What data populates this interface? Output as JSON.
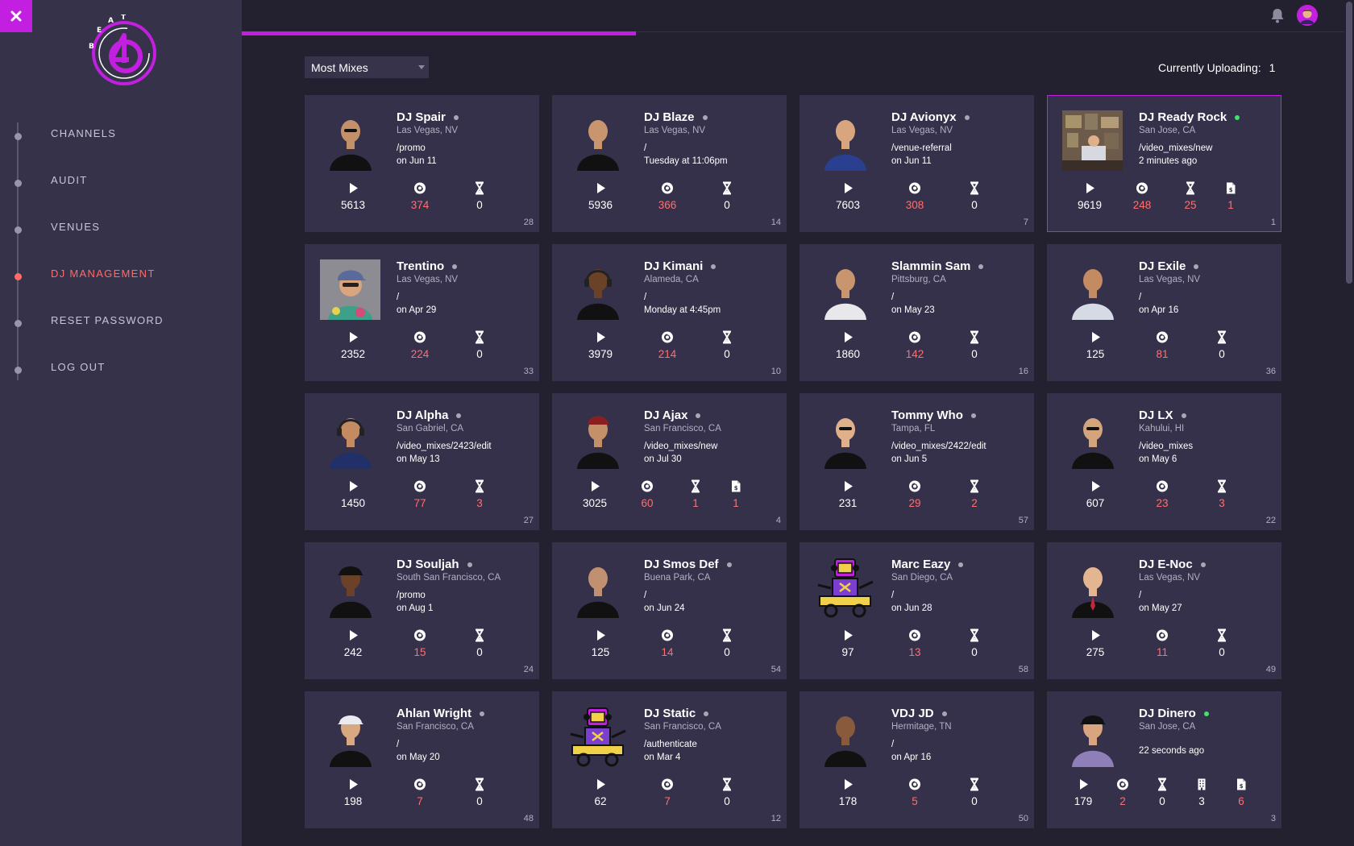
{
  "app": {
    "brand": "BEAT 45"
  },
  "sidebar": {
    "items": [
      {
        "label": "CHANNELS",
        "active": false
      },
      {
        "label": "AUDIT",
        "active": false
      },
      {
        "label": "VENUES",
        "active": false
      },
      {
        "label": "DJ MANAGEMENT",
        "active": true
      },
      {
        "label": "RESET PASSWORD",
        "active": false
      },
      {
        "label": "LOG OUT",
        "active": false
      }
    ]
  },
  "controls": {
    "sort_label": "Most Mixes",
    "uploading_label": "Currently Uploading:",
    "uploading_count": "1"
  },
  "colors": {
    "accent": "#c21fe0",
    "active_nav": "#ff6a6a",
    "online": "#3ee46a",
    "stat_red": "#ff6f6f"
  },
  "djs": [
    {
      "name": "DJ Spair",
      "location": "Las Vegas, NV",
      "path": "/promo",
      "time": "on Jun 11",
      "online": false,
      "plays": "5613",
      "mixes": "374",
      "pending": "0",
      "rank": "28",
      "photo": "man-sunglasses"
    },
    {
      "name": "DJ Blaze",
      "location": "Las Vegas, NV",
      "path": "/",
      "time": "Tuesday at 11:06pm",
      "online": false,
      "plays": "5936",
      "mixes": "366",
      "pending": "0",
      "rank": "14",
      "photo": "bald-man"
    },
    {
      "name": "DJ Avionyx",
      "location": "Las Vegas, NV",
      "path": "/venue-referral",
      "time": "on Jun 11",
      "online": false,
      "plays": "7603",
      "mixes": "308",
      "pending": "0",
      "rank": "7",
      "photo": "bald-man-blue"
    },
    {
      "name": "DJ Ready Rock",
      "location": "San Jose, CA",
      "path": "/video_mixes/new",
      "time": "2 minutes ago",
      "online": true,
      "highlight": true,
      "plays": "9619",
      "mixes": "248",
      "pending": "25",
      "invoices": "1",
      "rank": "1",
      "photo": "room-photo"
    },
    {
      "name": "Trentino",
      "location": "Las Vegas, NV",
      "path": "/",
      "time": "on Apr 29",
      "online": false,
      "plays": "2352",
      "mixes": "224",
      "pending": "0",
      "rank": "33",
      "photo": "man-cap-square"
    },
    {
      "name": "DJ Kimani",
      "location": "Alameda, CA",
      "path": "/",
      "time": "Monday at 4:45pm",
      "online": false,
      "plays": "3979",
      "mixes": "214",
      "pending": "0",
      "rank": "10",
      "photo": "man-headphones"
    },
    {
      "name": "Slammin Sam",
      "location": "Pittsburg, CA",
      "path": "/",
      "time": "on May 23",
      "online": false,
      "plays": "1860",
      "mixes": "142",
      "pending": "0",
      "rank": "16",
      "photo": "man-white-shirt"
    },
    {
      "name": "DJ Exile",
      "location": "Las Vegas, NV",
      "path": "/",
      "time": "on Apr 16",
      "online": false,
      "plays": "125",
      "mixes": "81",
      "pending": "0",
      "rank": "36",
      "photo": "man-hoodie"
    },
    {
      "name": "DJ Alpha",
      "location": "San Gabriel, CA",
      "path": "/video_mixes/2423/edit",
      "time": "on May 13",
      "online": false,
      "plays": "1450",
      "mixes": "77",
      "pending": "3",
      "rank": "27",
      "photo": "man-headphones-blue"
    },
    {
      "name": "DJ Ajax",
      "location": "San Francisco, CA",
      "path": "/video_mixes/new",
      "time": "on Jul 30",
      "online": false,
      "plays": "3025",
      "mixes": "60",
      "pending": "1",
      "invoices": "1",
      "rank": "4",
      "photo": "man-beanie"
    },
    {
      "name": "Tommy Who",
      "location": "Tampa, FL",
      "path": "/video_mixes/2422/edit",
      "time": "on Jun 5",
      "online": false,
      "plays": "231",
      "mixes": "29",
      "pending": "2",
      "rank": "57",
      "photo": "man-suit"
    },
    {
      "name": "DJ LX",
      "location": "Kahului, HI",
      "path": "/video_mixes",
      "time": "on May 6",
      "online": false,
      "plays": "607",
      "mixes": "23",
      "pending": "3",
      "rank": "22",
      "photo": "man-suit-pointing"
    },
    {
      "name": "DJ Souljah",
      "location": "South San Francisco, CA",
      "path": "/promo",
      "time": "on Aug 1",
      "online": false,
      "plays": "242",
      "mixes": "15",
      "pending": "0",
      "rank": "24",
      "photo": "man-black-cap"
    },
    {
      "name": "DJ Smos Def",
      "location": "Buena Park, CA",
      "path": "/",
      "time": "on Jun 24",
      "online": false,
      "plays": "125",
      "mixes": "14",
      "pending": "0",
      "rank": "54",
      "photo": "man-black-jacket"
    },
    {
      "name": "Marc Eazy",
      "location": "San Diego, CA",
      "path": "/",
      "time": "on Jun 28",
      "online": false,
      "plays": "97",
      "mixes": "13",
      "pending": "0",
      "rank": "58",
      "photo": "dj-robot-mascot"
    },
    {
      "name": "DJ E-Noc",
      "location": "Las Vegas, NV",
      "path": "/",
      "time": "on May 27",
      "online": false,
      "plays": "275",
      "mixes": "11",
      "pending": "0",
      "rank": "49",
      "photo": "man-red-tie"
    },
    {
      "name": "Ahlan Wright",
      "location": "San Francisco, CA",
      "path": "/",
      "time": "on May 20",
      "online": false,
      "plays": "198",
      "mixes": "7",
      "pending": "0",
      "rank": "48",
      "photo": "man-white-cap"
    },
    {
      "name": "DJ Static",
      "location": "San Francisco, CA",
      "path": "/authenticate",
      "time": "on Mar 4",
      "online": false,
      "plays": "62",
      "mixes": "7",
      "pending": "0",
      "rank": "12",
      "photo": "dj-robot-mascot"
    },
    {
      "name": "VDJ JD",
      "location": "Hermitage, TN",
      "path": "/",
      "time": "on Apr 16",
      "online": false,
      "plays": "178",
      "mixes": "5",
      "pending": "0",
      "rank": "50",
      "photo": "bald-man-black"
    },
    {
      "name": "DJ Dinero",
      "location": "San Jose, CA",
      "path": "",
      "time": "22 seconds ago",
      "online": true,
      "plays": "179",
      "mixes": "2",
      "pending": "0",
      "buildings": "3",
      "invoices": "6",
      "rank": "3",
      "photo": "man-cap-tilted"
    }
  ]
}
